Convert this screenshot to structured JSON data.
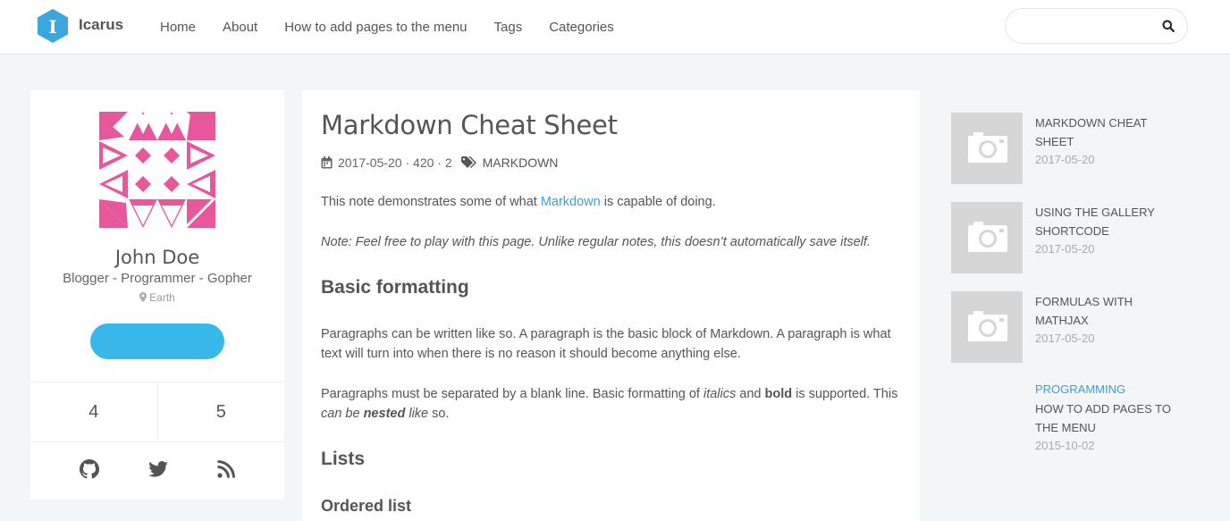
{
  "header": {
    "brand": "Icarus",
    "nav": [
      "Home",
      "About",
      "How to add pages to the menu",
      "Tags",
      "Categories"
    ],
    "search_placeholder": "",
    "colors": {
      "logo": "#3ba7e0",
      "accent": "#38b7ea"
    }
  },
  "profile": {
    "name": "John Doe",
    "tagline": "Blogger - Programmer - Gopher",
    "location": "Earth",
    "follow_label": "",
    "stats": [
      "4",
      "5"
    ],
    "social_icons": [
      "github-icon",
      "twitter-icon",
      "rss-icon"
    ],
    "avatar_color": "#e8579b"
  },
  "article": {
    "title": "Markdown Cheat Sheet",
    "meta": "2017-05-20 · 420 · 2",
    "tag": "MARKDOWN",
    "intro_before": "This note demonstrates some of what ",
    "intro_link": "Markdown",
    "intro_after": " is capable of doing.",
    "note": "Note: Feel free to play with this page. Unlike regular notes, this doesn’t automatically save itself.",
    "h_basic": "Basic formatting",
    "para1": "Paragraphs can be written like so. A paragraph is the basic block of Markdown. A paragraph is what text will turn into when there is no reason it should become anything else.",
    "para2_a": "Paragraphs must be separated by a blank line. Basic formatting of ",
    "para2_italics": "italics",
    "para2_b": " and ",
    "para2_bold": "bold",
    "para2_c": " is supported. This ",
    "para2_can_be": "can be ",
    "para2_nested": "nested",
    "para2_like": " like",
    "para2_end": " so.",
    "h_lists": "Lists",
    "h_ordered": "Ordered list"
  },
  "recent": [
    {
      "title_l1": "MARKDOWN CHEAT",
      "title_l2": "SHEET",
      "date": "2017-05-20"
    },
    {
      "title_l1": "USING THE GALLERY",
      "title_l2": "SHORTCODE",
      "date": "2017-05-20"
    },
    {
      "title_l1": "FORMULAS WITH",
      "title_l2": "MATHJAX",
      "date": "2017-05-20"
    },
    {
      "category": "PROGRAMMING",
      "title_l1": "HOW TO ADD PAGES TO",
      "title_l2": "THE MENU",
      "date": "2015-10-02"
    }
  ]
}
